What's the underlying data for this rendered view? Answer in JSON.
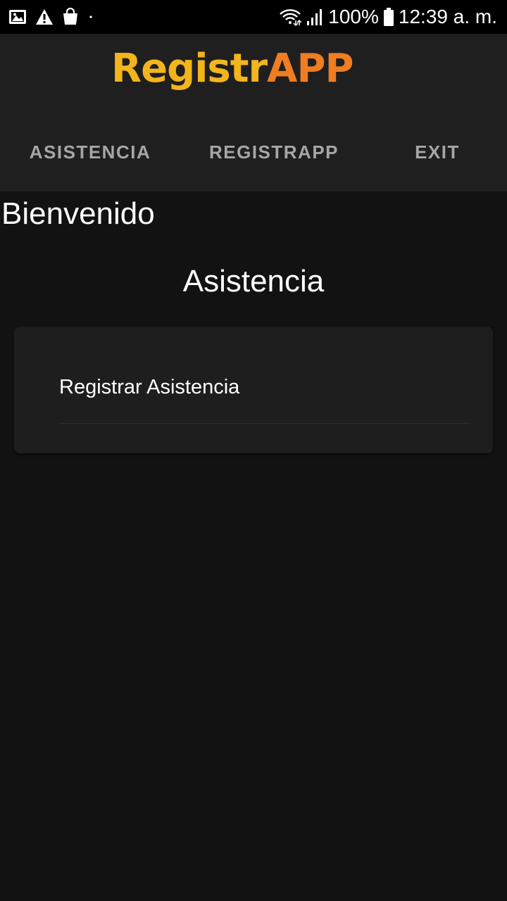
{
  "status_bar": {
    "battery": "100%",
    "time": "12:39 a. m.",
    "icons_left": [
      "image-icon",
      "warning-icon",
      "shopping-bag-icon",
      "dot-icon"
    ],
    "icons_right": [
      "wifi-icon",
      "signal-icon",
      "battery-icon"
    ]
  },
  "header": {
    "logo_part1": "Registr",
    "logo_part2": "APP",
    "logo_colors": {
      "part1": "#f2b51c",
      "part2": "#ef7d22"
    },
    "tabs": [
      {
        "label": "ASISTENCIA"
      },
      {
        "label": "REGISTRAPP"
      },
      {
        "label": "EXIT"
      }
    ]
  },
  "main": {
    "welcome": "Bienvenido",
    "section_title": "Asistencia",
    "items": [
      {
        "label": "Registrar Asistencia"
      }
    ]
  },
  "colors": {
    "background": "#121212",
    "toolbar": "#1f1f1f",
    "card": "#1e1e1e",
    "tab_text": "#a6a6a6"
  }
}
